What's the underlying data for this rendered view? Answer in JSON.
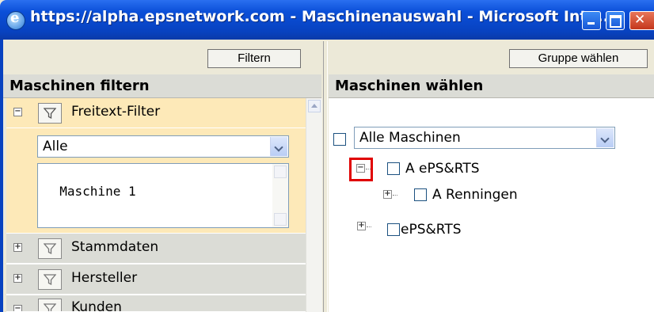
{
  "window": {
    "title": "https://alpha.epsnetwork.com - Maschinenauswahl - Microsoft Inte..."
  },
  "left": {
    "filter_button": "Filtern",
    "heading": "Maschinen filtern",
    "groups": [
      {
        "label": "Freitext-Filter",
        "toggle": "−",
        "expanded": true
      },
      {
        "label": "Stammdaten",
        "toggle": "+",
        "expanded": false
      },
      {
        "label": "Hersteller",
        "toggle": "+",
        "expanded": false
      },
      {
        "label": "Kunden",
        "toggle": "−",
        "expanded": false
      }
    ],
    "freitext": {
      "select_value": "Alle",
      "text_value": "Maschine 1"
    }
  },
  "right": {
    "group_button": "Gruppe wählen",
    "heading": "Maschinen wählen",
    "select_value": "Alle Maschinen",
    "tree": [
      {
        "label": "A ePS&RTS",
        "toggle": "−"
      },
      {
        "label": "A Renningen",
        "toggle": "+"
      },
      {
        "label": "ePS&RTS",
        "toggle": "+"
      }
    ]
  },
  "colors": {
    "titlebar": "#0a4fd8",
    "active_group": "#fde9b8",
    "group_bg": "#dbdcd6",
    "highlight": "#e00000"
  }
}
